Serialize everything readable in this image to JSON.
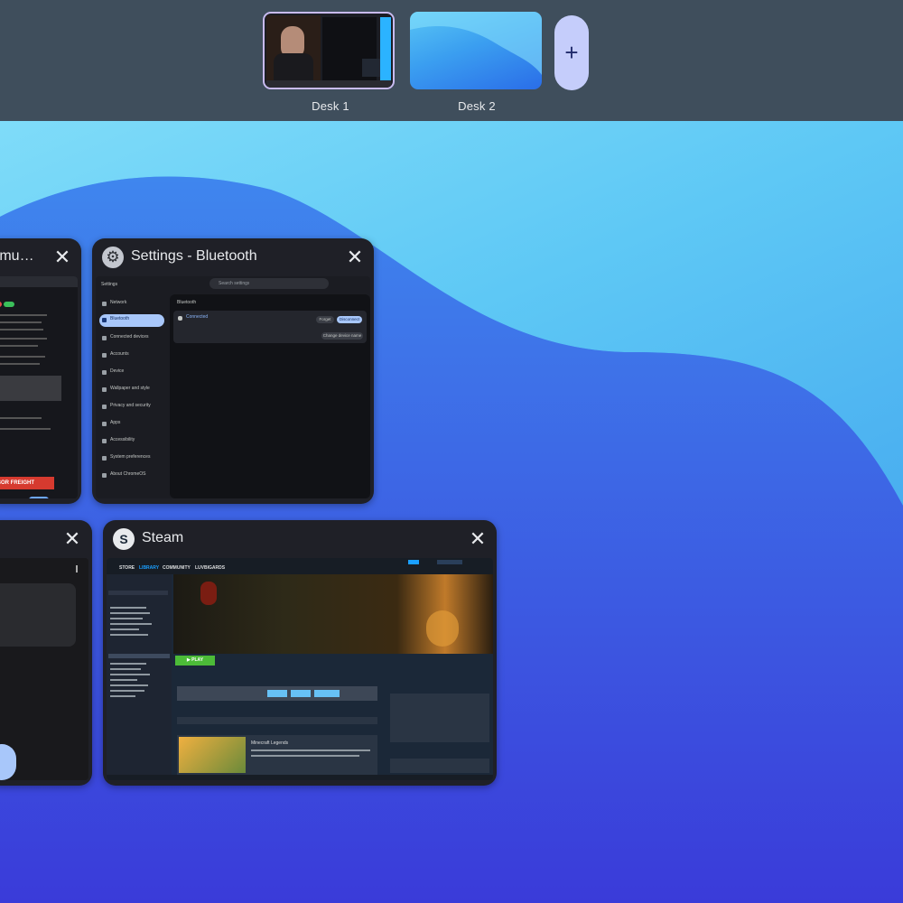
{
  "desks": {
    "items": [
      {
        "label": "Desk 1",
        "active": true
      },
      {
        "label": "Desk 2",
        "active": false
      }
    ],
    "add_symbol": "+"
  },
  "windows": {
    "chrome": {
      "title": "a mu…",
      "close_symbol": "✕",
      "banner_text": "ARBOR FREIGHT"
    },
    "bluetooth": {
      "title": "Settings - Bluetooth",
      "close_symbol": "✕",
      "icon": "gear-icon",
      "search_placeholder": "Search settings",
      "sidebar_heading": "Settings",
      "sidebar_items": [
        "Network",
        "Bluetooth",
        "Connected devices",
        "Accounts",
        "Device",
        "Wallpaper and style",
        "Privacy and security",
        "Apps",
        "Accessibility",
        "System preferences",
        "About ChromeOS"
      ],
      "page_title": "Bluetooth",
      "device_name": "Connected",
      "forget_label": "Forget",
      "disconnect_label": "Disconnect",
      "change_name_label": "Change device name"
    },
    "left2": {
      "close_symbol": "✕"
    },
    "steam": {
      "title": "Steam",
      "close_symbol": "✕",
      "icon": "steam-icon",
      "nav": [
        "STORE",
        "LIBRARY",
        "COMMUNITY",
        "LUVBIGARDS"
      ],
      "play_label": "▶ PLAY",
      "news_title": "Minecraft Legends"
    }
  }
}
